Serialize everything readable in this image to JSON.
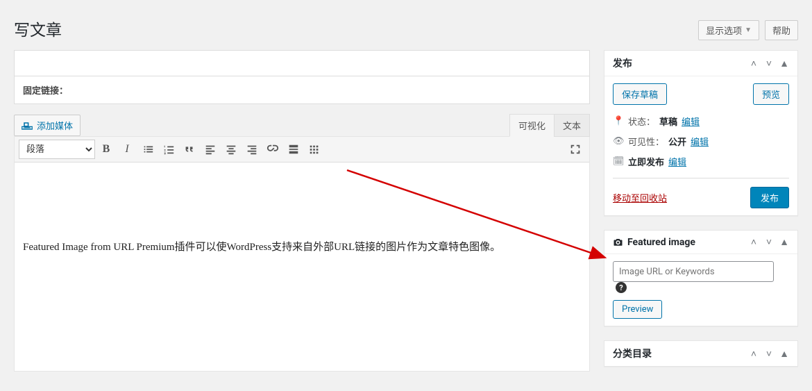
{
  "top": {
    "screen_options": "显示选项",
    "help": "帮助"
  },
  "page_title": "写文章",
  "permalink_label": "固定链接：",
  "add_media": "添加媒体",
  "editor_tabs": {
    "visual": "可视化",
    "text": "文本"
  },
  "toolbar": {
    "format_selected": "段落"
  },
  "editor_content": "Featured Image from URL Premium插件可以使WordPress支持来自外部URL链接的图片作为文章特色图像。",
  "publish": {
    "title": "发布",
    "save_draft": "保存草稿",
    "preview": "预览",
    "status_label": "状态：",
    "status_value": "草稿",
    "visibility_label": "可见性：",
    "visibility_value": "公开",
    "schedule_label": "立即发布",
    "edit": "编辑",
    "trash": "移动至回收站",
    "publish_btn": "发布"
  },
  "featured_image": {
    "title": "Featured image",
    "placeholder": "Image URL or Keywords",
    "preview": "Preview"
  },
  "categories": {
    "title": "分类目录"
  }
}
